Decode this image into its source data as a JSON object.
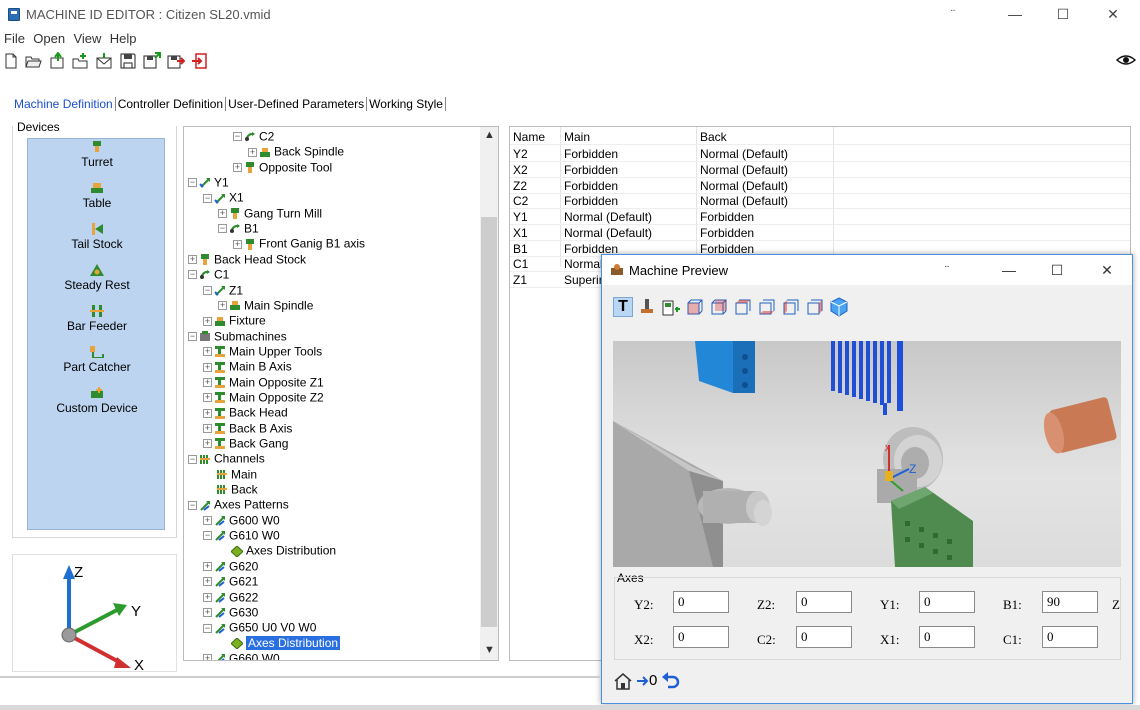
{
  "window": {
    "title": "MACHINE ID EDITOR : Citizen SL20.vmid",
    "extra_glyph": "¨",
    "minimize": "—",
    "maximize": "☐",
    "close": "✕"
  },
  "menu": [
    "File",
    "Open",
    "View",
    "Help"
  ],
  "tabs": [
    "Machine Definition",
    "Controller Definition",
    "User-Defined Parameters",
    "Working Style"
  ],
  "devices": {
    "label": "Devices",
    "items": [
      "Turret",
      "Table",
      "Tail Stock",
      "Steady Rest",
      "Bar Feeder",
      "Part Catcher",
      "Custom Device"
    ]
  },
  "gizmo": {
    "z": "Z",
    "y": "Y",
    "x": "X"
  },
  "tree": [
    {
      "label": "C2",
      "level": 3,
      "exp": "−",
      "icon": "rot"
    },
    {
      "label": "Back Spindle",
      "level": 4,
      "exp": "+",
      "icon": "spindle"
    },
    {
      "label": "Opposite Tool",
      "level": 3,
      "exp": "+",
      "icon": "turret"
    },
    {
      "label": "Y1",
      "level": 0,
      "exp": "−",
      "icon": "lin"
    },
    {
      "label": "X1",
      "level": 1,
      "exp": "−",
      "icon": "lin"
    },
    {
      "label": "Gang Turn Mill",
      "level": 2,
      "exp": "+",
      "icon": "turret"
    },
    {
      "label": "B1",
      "level": 2,
      "exp": "−",
      "icon": "rot"
    },
    {
      "label": "Front Ganig B1 axis",
      "level": 3,
      "exp": "+",
      "icon": "turret"
    },
    {
      "label": "Back Head Stock",
      "level": 0,
      "exp": "+",
      "icon": "turret"
    },
    {
      "label": "C1",
      "level": 0,
      "exp": "−",
      "icon": "rot"
    },
    {
      "label": "Z1",
      "level": 1,
      "exp": "−",
      "icon": "lin"
    },
    {
      "label": "Main Spindle",
      "level": 2,
      "exp": "+",
      "icon": "spindle"
    },
    {
      "label": "Fixture",
      "level": 1,
      "exp": "+",
      "icon": "spindle"
    },
    {
      "label": "Submachines",
      "level": 0,
      "exp": "−",
      "icon": "sub"
    },
    {
      "label": "Main Upper Tools",
      "level": 1,
      "exp": "+",
      "icon": "subm"
    },
    {
      "label": "Main B Axis",
      "level": 1,
      "exp": "+",
      "icon": "subm"
    },
    {
      "label": "Main Opposite Z1",
      "level": 1,
      "exp": "+",
      "icon": "subm"
    },
    {
      "label": "Main Opposite Z2",
      "level": 1,
      "exp": "+",
      "icon": "subm"
    },
    {
      "label": "Back Head",
      "level": 1,
      "exp": "+",
      "icon": "subm"
    },
    {
      "label": "Back B Axis",
      "level": 1,
      "exp": "+",
      "icon": "subm"
    },
    {
      "label": "Back Gang",
      "level": 1,
      "exp": "+",
      "icon": "subm"
    },
    {
      "label": "Channels",
      "level": 0,
      "exp": "−",
      "icon": "chan"
    },
    {
      "label": "Main",
      "level": 1,
      "exp": "",
      "icon": "chan"
    },
    {
      "label": "Back",
      "level": 1,
      "exp": "",
      "icon": "chan"
    },
    {
      "label": "Axes Patterns",
      "level": 0,
      "exp": "−",
      "icon": "pat"
    },
    {
      "label": "G600 W0",
      "level": 1,
      "exp": "+",
      "icon": "pat"
    },
    {
      "label": "G610 W0",
      "level": 1,
      "exp": "−",
      "icon": "pat"
    },
    {
      "label": "Axes Distribution",
      "level": 2,
      "exp": "",
      "icon": "dist"
    },
    {
      "label": "G620",
      "level": 1,
      "exp": "+",
      "icon": "pat"
    },
    {
      "label": "G621",
      "level": 1,
      "exp": "+",
      "icon": "pat"
    },
    {
      "label": "G622",
      "level": 1,
      "exp": "+",
      "icon": "pat"
    },
    {
      "label": "G630",
      "level": 1,
      "exp": "+",
      "icon": "pat"
    },
    {
      "label": "G650 U0 V0 W0",
      "level": 1,
      "exp": "−",
      "icon": "pat"
    },
    {
      "label": "Axes Distribution",
      "level": 2,
      "exp": "",
      "icon": "dist",
      "selected": true
    },
    {
      "label": "G660 W0",
      "level": 1,
      "exp": "+",
      "icon": "pat"
    }
  ],
  "table": {
    "headers": [
      "Name",
      "Main",
      "Back"
    ],
    "rows": [
      [
        "Y2",
        "Forbidden",
        "Normal (Default)"
      ],
      [
        "X2",
        "Forbidden",
        "Normal (Default)"
      ],
      [
        "Z2",
        "Forbidden",
        "Normal (Default)"
      ],
      [
        "C2",
        "Forbidden",
        "Normal (Default)"
      ],
      [
        "Y1",
        "Normal (Default)",
        "Forbidden"
      ],
      [
        "X1",
        "Normal (Default)",
        "Forbidden"
      ],
      [
        "B1",
        "Forbidden",
        "Forbidden"
      ],
      [
        "C1",
        "Normal",
        ""
      ],
      [
        "Z1",
        "Superin",
        ""
      ]
    ]
  },
  "preview": {
    "title": "Machine Preview",
    "extra_glyph": "¨",
    "axes_label": "Axes",
    "fields": [
      {
        "label": "Y2:",
        "value": "0"
      },
      {
        "label": "Z2:",
        "value": "0"
      },
      {
        "label": "Y1:",
        "value": "0"
      },
      {
        "label": "B1:",
        "value": "90"
      },
      {
        "label": "X2:",
        "value": "0"
      },
      {
        "label": "C2:",
        "value": "0"
      },
      {
        "label": "X1:",
        "value": "0"
      },
      {
        "label": "C1:",
        "value": "0"
      }
    ],
    "overflow_label": "Z",
    "bottom_zero": "0",
    "viewport_axes": {
      "x": "x",
      "z": "Z"
    }
  },
  "colors": {
    "accent": "#1a4fd0",
    "selection": "#2a6fe0",
    "devices_bg": "#bdd4f0",
    "green": "#2e8b2e",
    "orange": "#e8a33a"
  }
}
